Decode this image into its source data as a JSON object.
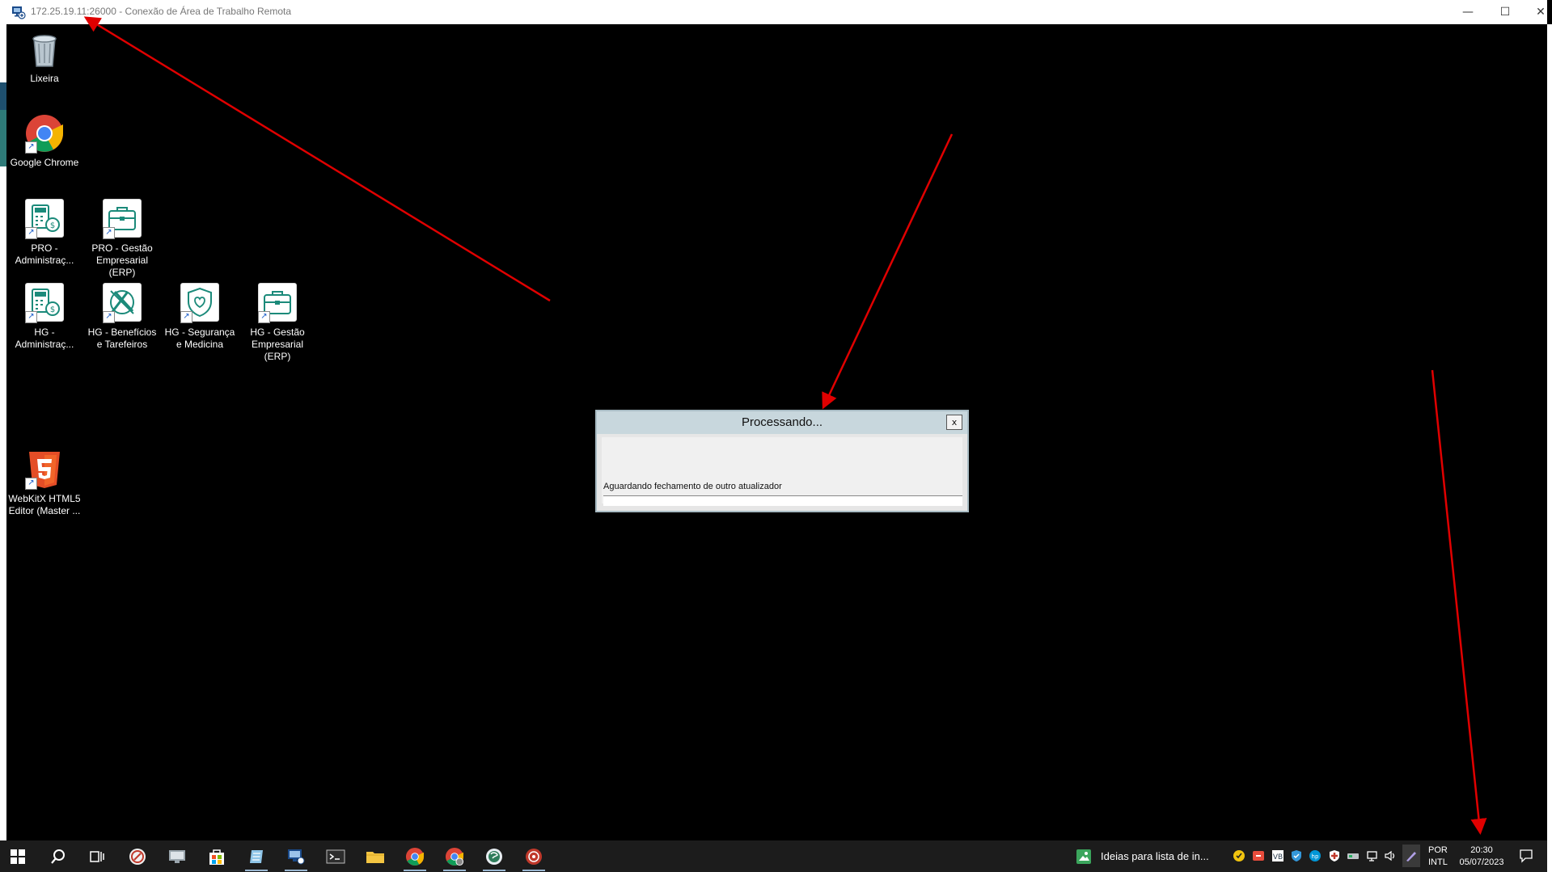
{
  "window": {
    "title": "172.25.19.11:26000 - Conexão de Área de Trabalho Remota",
    "minimize_glyph": "—",
    "maximize_glyph": "☐",
    "close_glyph": "✕"
  },
  "desktop": {
    "icons": [
      {
        "name": "recycle-bin",
        "label": "Lixeira"
      },
      {
        "name": "google-chrome",
        "label": "Google Chrome"
      },
      {
        "name": "pro-administracao",
        "label": "PRO - Administraç..."
      },
      {
        "name": "pro-gestao-empresarial",
        "label": "PRO - Gestão Empresarial (ERP)"
      },
      {
        "name": "hg-administracao",
        "label": "HG - Administraç..."
      },
      {
        "name": "hg-beneficios",
        "label": "HG - Benefícios e Tarefeiros"
      },
      {
        "name": "hg-seguranca",
        "label": "HG - Segurança e Medicina"
      },
      {
        "name": "hg-gestao-empresarial",
        "label": "HG - Gestão Empresarial (ERP)"
      },
      {
        "name": "webkitx-editor",
        "label": "WebKitX HTML5 Editor (Master ..."
      }
    ]
  },
  "dialog": {
    "title": "Processando...",
    "close_label": "x",
    "message": "Aguardando fechamento de outro atualizador",
    "progress": 0
  },
  "taskbar": {
    "pinned_window_label": "Ideias para lista de in...",
    "language_line1": "POR",
    "language_line2": "INTL",
    "time": "20:30",
    "date": "05/07/2023"
  },
  "colors": {
    "annotation_arrow": "#e00000",
    "dialog_title_bg": "#c8d7dd",
    "taskbar_bg": "#1c1c1c",
    "icon_teal": "#1b8a7a"
  }
}
